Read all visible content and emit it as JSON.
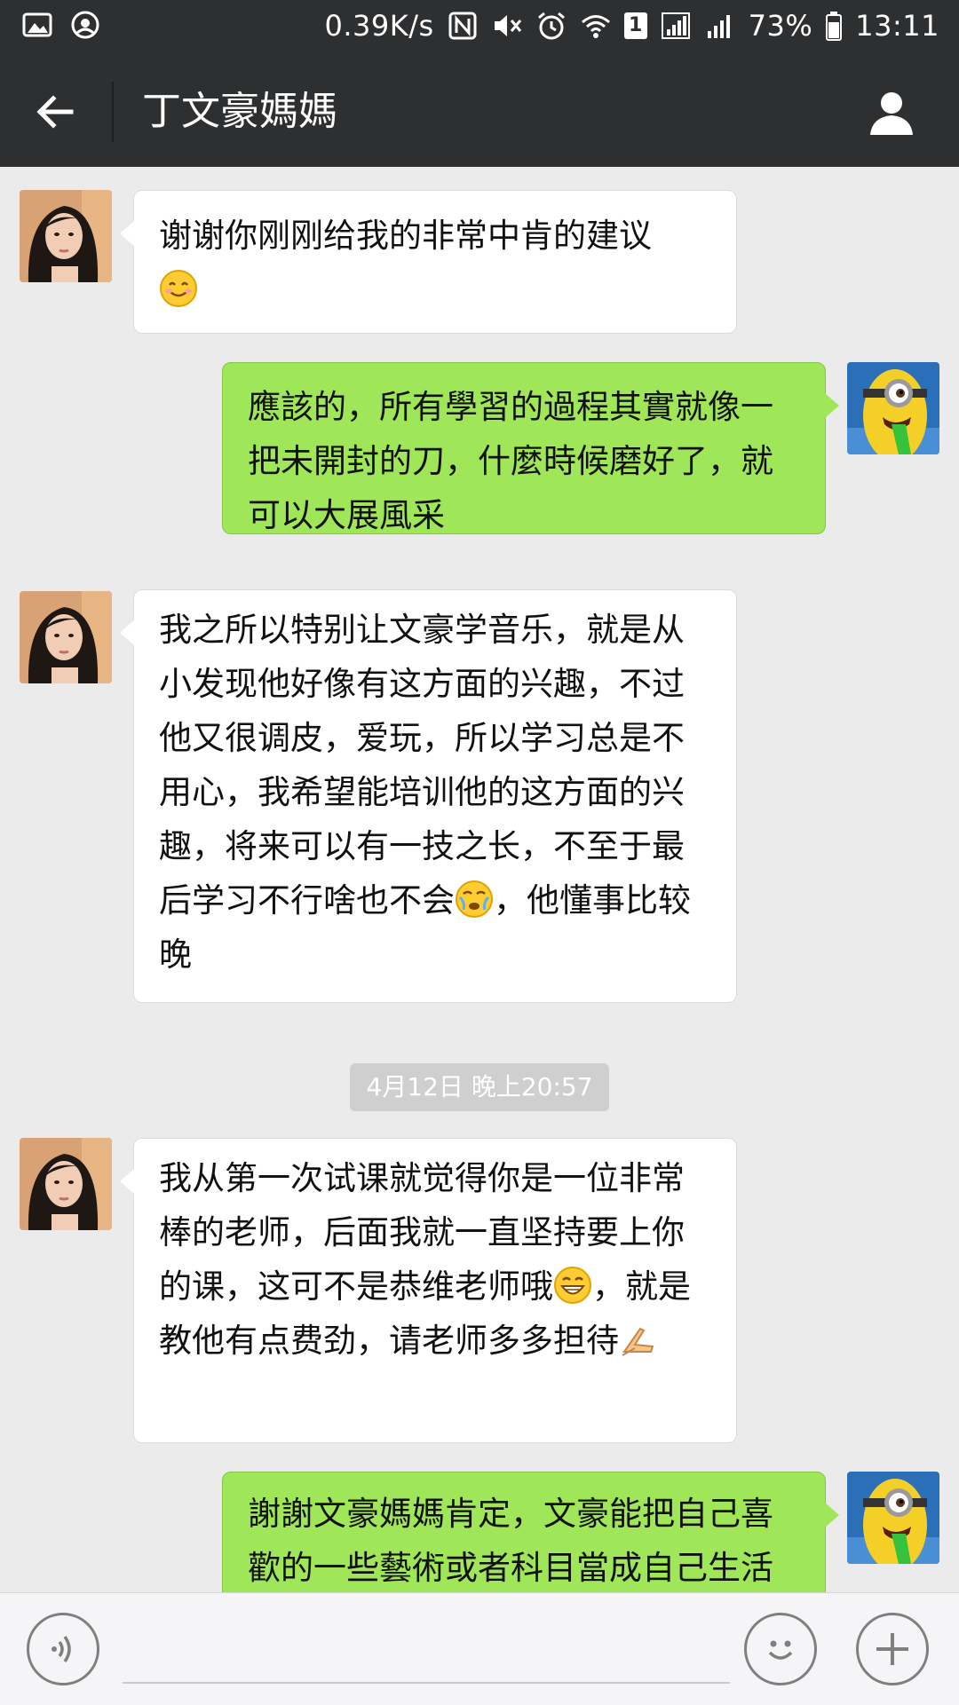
{
  "status_bar": {
    "network_speed": "0.39K/s",
    "battery": "73%",
    "time": "13:11",
    "sim_badge": "1",
    "icons": [
      "image-icon",
      "at-sign-icon",
      "nfc-icon",
      "mute-icon",
      "alarm-icon",
      "wifi-icon",
      "signal-icon",
      "battery-icon"
    ]
  },
  "header": {
    "title": "丁文豪媽媽",
    "icons": [
      "back-arrow-icon",
      "profile-icon"
    ]
  },
  "messages": [
    {
      "from": "contact",
      "text": "谢谢你刚刚给我的非常中肯的建议",
      "emoji": "smiling-face-icon"
    },
    {
      "from": "me",
      "text": "應該的，所有學習的過程其實就像一把未開封的刀，什麼時候磨好了，就可以大展風采"
    },
    {
      "from": "contact",
      "text_before_emoji": "我之所以特别让文豪学音乐，就是从小发现他好像有这方面的兴趣，不过他又很调皮，爱玩，所以学习总是不用心，我希望能培训他的这方面的兴趣，将来可以有一技之长，不至于最后学习不行啥也不会",
      "emoji": "facepalm-face-icon",
      "text_after_emoji": "，他懂事比较晚"
    },
    {
      "from": "contact",
      "text_before_emoji": "我从第一次试课就觉得你是一位非常棒的老师，后面我就一直坚持要上你的课，这可不是恭维老师哦",
      "emoji": "grinning-face-icon",
      "text_after_emoji": "，就是教他有点费劲，请老师多多担待",
      "emoji2": "folded-hands-icon"
    },
    {
      "from": "me",
      "text": "謝謝文豪媽媽肯定，文豪能把自己喜歡的一些藝術或者科目當成自己生活"
    }
  ],
  "timestamp": "4月12日 晚上20:57",
  "input_bar": {
    "placeholder": "",
    "icons": [
      "voice-icon",
      "emoji-face-icon",
      "plus-icon"
    ]
  },
  "colors": {
    "header_bg": "#2e2f31",
    "chat_bg": "#ebebeb",
    "outgoing_bubble": "#9fe658",
    "incoming_bubble": "#ffffff",
    "timestamp_bg": "#cfcfcf"
  }
}
